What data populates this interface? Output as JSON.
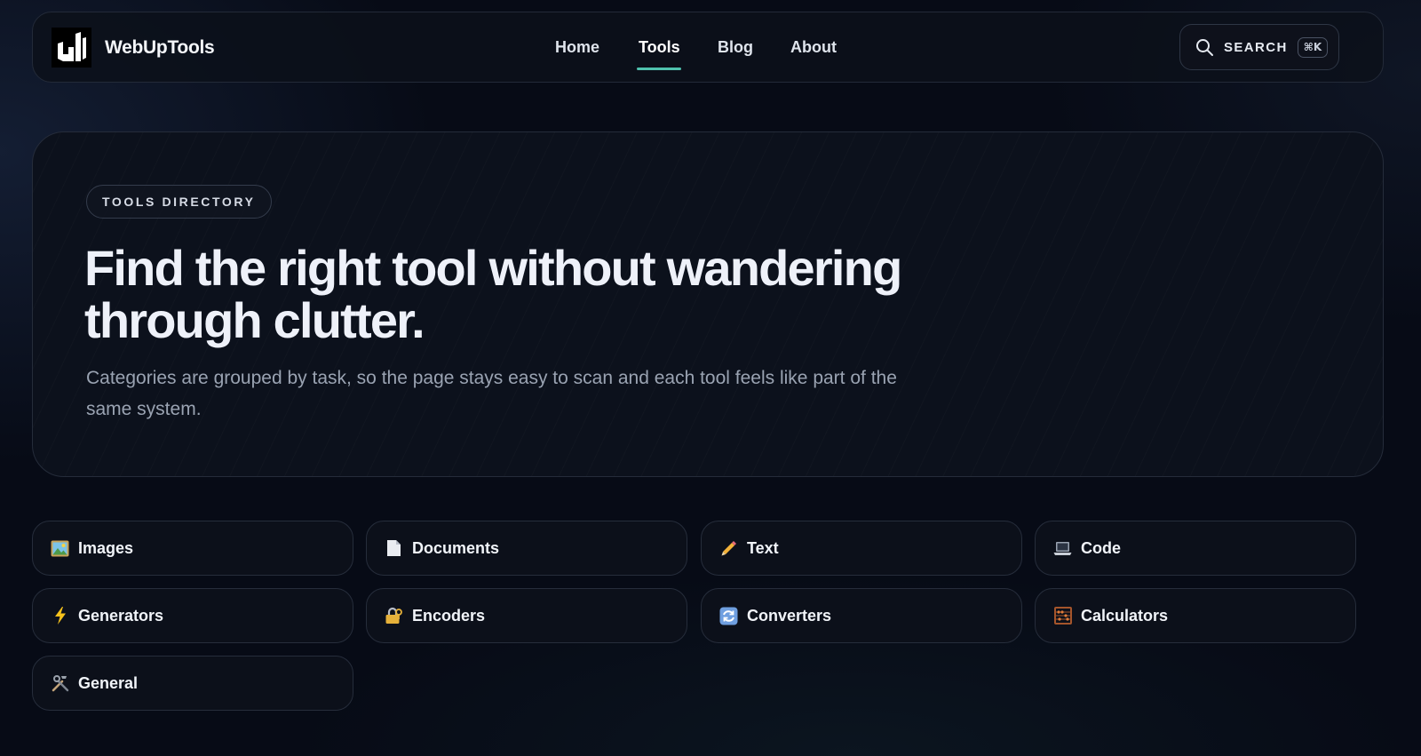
{
  "header": {
    "brand_name": "WebUpTools",
    "nav": [
      {
        "label": "Home",
        "active": false
      },
      {
        "label": "Tools",
        "active": true
      },
      {
        "label": "Blog",
        "active": false
      },
      {
        "label": "About",
        "active": false
      }
    ],
    "search_label": "SEARCH",
    "search_shortcut": "⌘K"
  },
  "hero": {
    "badge": "TOOLS DIRECTORY",
    "title": "Find the right tool without wandering through clutter.",
    "description": "Categories are grouped by task, so the page stays easy to scan and each tool feels like part of the same system."
  },
  "categories": [
    {
      "label": "Images",
      "icon": "image-icon"
    },
    {
      "label": "Documents",
      "icon": "document-icon"
    },
    {
      "label": "Text",
      "icon": "pencil-icon"
    },
    {
      "label": "Code",
      "icon": "laptop-icon"
    },
    {
      "label": "Generators",
      "icon": "lightning-icon"
    },
    {
      "label": "Encoders",
      "icon": "lock-icon"
    },
    {
      "label": "Converters",
      "icon": "refresh-icon"
    },
    {
      "label": "Calculators",
      "icon": "abacus-icon"
    },
    {
      "label": "General",
      "icon": "tools-icon"
    }
  ],
  "colors": {
    "accent": "#4fc1ad",
    "background": "#070b16",
    "card": "#0c111c"
  }
}
